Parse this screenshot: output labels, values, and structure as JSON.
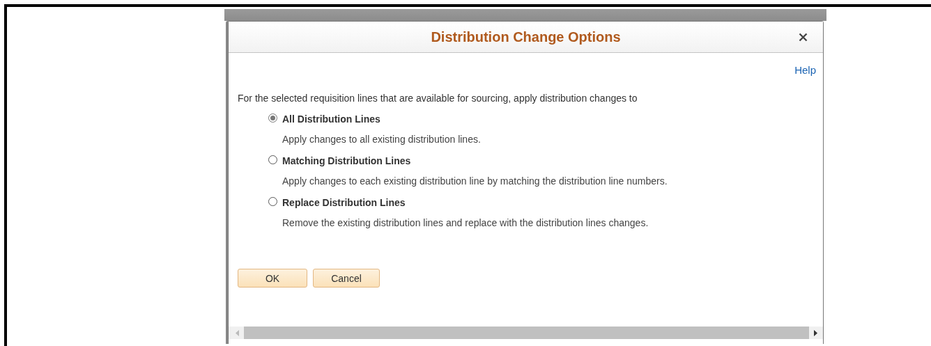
{
  "dialog": {
    "title": "Distribution Change Options",
    "help_link": "Help",
    "intro": "For the selected requisition lines that are available for sourcing, apply distribution changes to",
    "options": [
      {
        "label": "All Distribution Lines",
        "description": "Apply changes to all existing distribution lines.",
        "selected": true
      },
      {
        "label": "Matching Distribution Lines",
        "description": "Apply changes to each existing distribution line by matching the distribution line numbers.",
        "selected": false
      },
      {
        "label": "Replace Distribution Lines",
        "description": "Remove the existing distribution lines and replace with the distribution lines changes.",
        "selected": false
      }
    ],
    "buttons": [
      "OK",
      "Cancel"
    ]
  }
}
